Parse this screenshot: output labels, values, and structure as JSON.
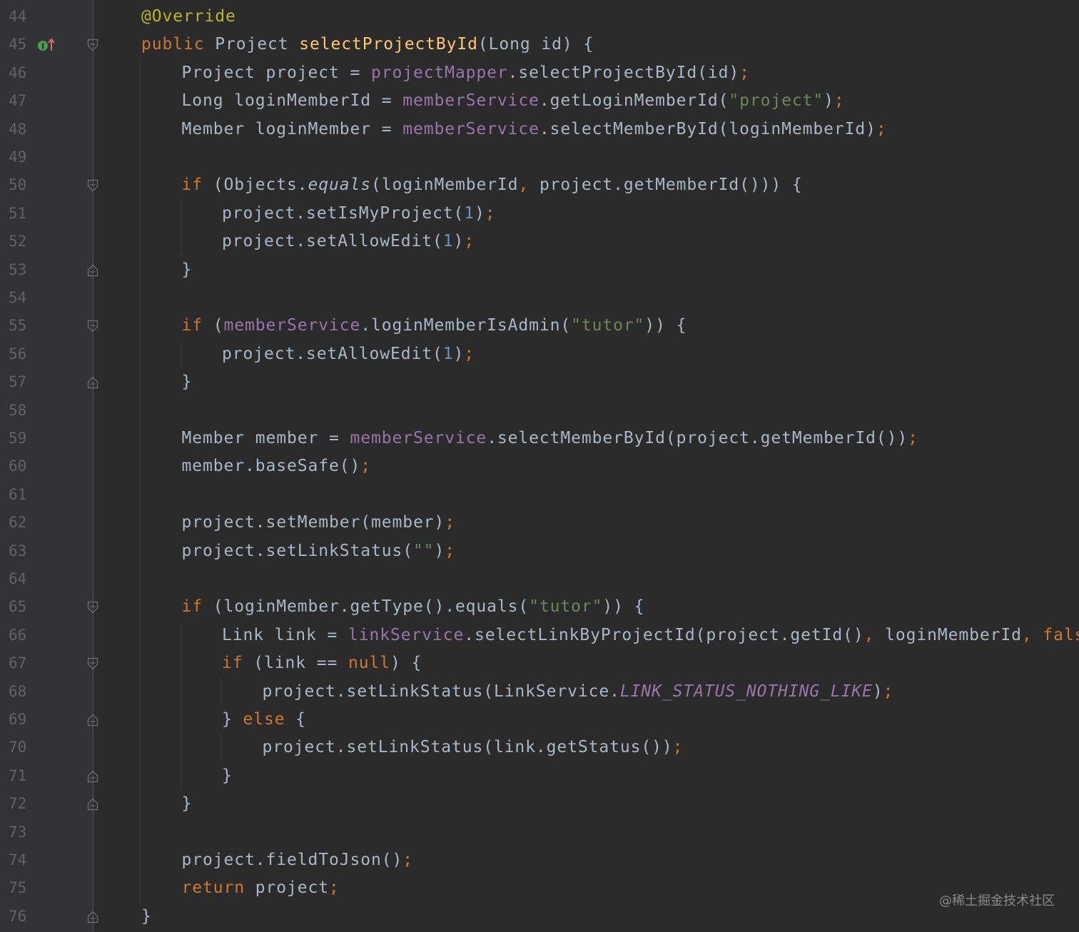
{
  "editor": {
    "lines": [
      {
        "num": "44",
        "indent": 0,
        "fold": "",
        "tokens": [
          [
            "ann",
            "@Override"
          ]
        ]
      },
      {
        "num": "45",
        "indent": 0,
        "fold": "open",
        "tokens": [
          [
            "kw",
            "public "
          ],
          [
            "plain",
            "Project "
          ],
          [
            "fn",
            "selectProjectById"
          ],
          [
            "plain",
            "(Long id) {"
          ]
        ]
      },
      {
        "num": "46",
        "indent": 1,
        "fold": "",
        "tokens": [
          [
            "plain",
            "Project project = "
          ],
          [
            "fld",
            "projectMapper"
          ],
          [
            "plain",
            ".selectProjectById(id)"
          ],
          [
            "semi",
            ";"
          ]
        ]
      },
      {
        "num": "47",
        "indent": 1,
        "fold": "",
        "tokens": [
          [
            "plain",
            "Long loginMemberId = "
          ],
          [
            "fld",
            "memberService"
          ],
          [
            "plain",
            ".getLoginMemberId("
          ],
          [
            "str",
            "\"project\""
          ],
          [
            "plain",
            ")"
          ],
          [
            "semi",
            ";"
          ]
        ]
      },
      {
        "num": "48",
        "indent": 1,
        "fold": "",
        "tokens": [
          [
            "plain",
            "Member loginMember = "
          ],
          [
            "fld",
            "memberService"
          ],
          [
            "plain",
            ".selectMemberById(loginMemberId)"
          ],
          [
            "semi",
            ";"
          ]
        ]
      },
      {
        "num": "49",
        "indent": 0,
        "fold": "",
        "tokens": []
      },
      {
        "num": "50",
        "indent": 1,
        "fold": "open",
        "tokens": [
          [
            "kw",
            "if "
          ],
          [
            "plain",
            "(Objects."
          ],
          [
            "ital",
            "equals"
          ],
          [
            "plain",
            "(loginMemberId"
          ],
          [
            "semi",
            ", "
          ],
          [
            "plain",
            "project.getMemberId())) {"
          ]
        ]
      },
      {
        "num": "51",
        "indent": 2,
        "fold": "",
        "tokens": [
          [
            "plain",
            "project.setIsMyProject("
          ],
          [
            "num",
            "1"
          ],
          [
            "plain",
            ")"
          ],
          [
            "semi",
            ";"
          ]
        ]
      },
      {
        "num": "52",
        "indent": 2,
        "fold": "",
        "tokens": [
          [
            "plain",
            "project.setAllowEdit("
          ],
          [
            "num",
            "1"
          ],
          [
            "plain",
            ")"
          ],
          [
            "semi",
            ";"
          ]
        ]
      },
      {
        "num": "53",
        "indent": 1,
        "fold": "close",
        "tokens": [
          [
            "plain",
            "}"
          ]
        ]
      },
      {
        "num": "54",
        "indent": 0,
        "fold": "",
        "tokens": []
      },
      {
        "num": "55",
        "indent": 1,
        "fold": "open",
        "tokens": [
          [
            "kw",
            "if "
          ],
          [
            "plain",
            "("
          ],
          [
            "fld",
            "memberService"
          ],
          [
            "plain",
            ".loginMemberIsAdmin("
          ],
          [
            "str",
            "\"tutor\""
          ],
          [
            "plain",
            ")) {"
          ]
        ]
      },
      {
        "num": "56",
        "indent": 2,
        "fold": "",
        "tokens": [
          [
            "plain",
            "project.setAllowEdit("
          ],
          [
            "num",
            "1"
          ],
          [
            "plain",
            ")"
          ],
          [
            "semi",
            ";"
          ]
        ]
      },
      {
        "num": "57",
        "indent": 1,
        "fold": "close",
        "tokens": [
          [
            "plain",
            "}"
          ]
        ]
      },
      {
        "num": "58",
        "indent": 0,
        "fold": "",
        "tokens": []
      },
      {
        "num": "59",
        "indent": 1,
        "fold": "",
        "tokens": [
          [
            "plain",
            "Member member = "
          ],
          [
            "fld",
            "memberService"
          ],
          [
            "plain",
            ".selectMemberById(project.getMemberId())"
          ],
          [
            "semi",
            ";"
          ]
        ]
      },
      {
        "num": "60",
        "indent": 1,
        "fold": "",
        "tokens": [
          [
            "plain",
            "member.baseSafe()"
          ],
          [
            "semi",
            ";"
          ]
        ]
      },
      {
        "num": "61",
        "indent": 0,
        "fold": "",
        "tokens": []
      },
      {
        "num": "62",
        "indent": 1,
        "fold": "",
        "tokens": [
          [
            "plain",
            "project.setMember(member)"
          ],
          [
            "semi",
            ";"
          ]
        ]
      },
      {
        "num": "63",
        "indent": 1,
        "fold": "",
        "tokens": [
          [
            "plain",
            "project.setLinkStatus("
          ],
          [
            "str",
            "\"\""
          ],
          [
            "plain",
            ")"
          ],
          [
            "semi",
            ";"
          ]
        ]
      },
      {
        "num": "64",
        "indent": 0,
        "fold": "",
        "tokens": []
      },
      {
        "num": "65",
        "indent": 1,
        "fold": "open",
        "tokens": [
          [
            "kw",
            "if "
          ],
          [
            "plain",
            "(loginMember.getType().equals("
          ],
          [
            "str",
            "\"tutor\""
          ],
          [
            "plain",
            ")) {"
          ]
        ]
      },
      {
        "num": "66",
        "indent": 2,
        "fold": "",
        "tokens": [
          [
            "plain",
            "Link link = "
          ],
          [
            "fld",
            "linkService"
          ],
          [
            "plain",
            ".selectLinkByProjectId(project.getId()"
          ],
          [
            "semi",
            ", "
          ],
          [
            "plain",
            "loginMemberId"
          ],
          [
            "semi",
            ", "
          ],
          [
            "kw",
            "false"
          ],
          [
            "plain",
            ")"
          ],
          [
            "semi",
            ";"
          ]
        ]
      },
      {
        "num": "67",
        "indent": 2,
        "fold": "open",
        "tokens": [
          [
            "kw",
            "if "
          ],
          [
            "plain",
            "(link == "
          ],
          [
            "kw",
            "null"
          ],
          [
            "plain",
            ") {"
          ]
        ]
      },
      {
        "num": "68",
        "indent": 3,
        "fold": "",
        "tokens": [
          [
            "plain",
            "project.setLinkStatus(LinkService."
          ],
          [
            "static",
            "LINK_STATUS_NOTHING_LIKE"
          ],
          [
            "plain",
            ")"
          ],
          [
            "semi",
            ";"
          ]
        ]
      },
      {
        "num": "69",
        "indent": 2,
        "fold": "close",
        "tokens": [
          [
            "plain",
            "} "
          ],
          [
            "kw",
            "else "
          ],
          [
            "plain",
            "{"
          ]
        ]
      },
      {
        "num": "70",
        "indent": 3,
        "fold": "",
        "tokens": [
          [
            "plain",
            "project.setLinkStatus(link.getStatus())"
          ],
          [
            "semi",
            ";"
          ]
        ]
      },
      {
        "num": "71",
        "indent": 2,
        "fold": "close",
        "tokens": [
          [
            "plain",
            "}"
          ]
        ]
      },
      {
        "num": "72",
        "indent": 1,
        "fold": "close",
        "tokens": [
          [
            "plain",
            "}"
          ]
        ]
      },
      {
        "num": "73",
        "indent": 0,
        "fold": "",
        "tokens": []
      },
      {
        "num": "74",
        "indent": 1,
        "fold": "",
        "tokens": [
          [
            "plain",
            "project.fieldToJson()"
          ],
          [
            "semi",
            ";"
          ]
        ]
      },
      {
        "num": "75",
        "indent": 1,
        "fold": "",
        "tokens": [
          [
            "kw",
            "return "
          ],
          [
            "plain",
            "project"
          ],
          [
            "semi",
            ";"
          ]
        ]
      },
      {
        "num": "76",
        "indent": 0,
        "fold": "close",
        "tokens": [
          [
            "plain",
            "}"
          ]
        ]
      }
    ]
  },
  "gutter": {
    "override_icon": "override-method-icon",
    "override_marker_line": "45"
  },
  "watermark": "@稀土掘金技术社区",
  "colors": {
    "background": "#2b2b2b",
    "gutter": "#313335",
    "keyword": "#cc7832",
    "annotation": "#bbb529",
    "method_declaration": "#ffc66d",
    "field": "#9876aa",
    "string": "#6a8759",
    "number": "#6897bb",
    "text": "#a9b7c6",
    "line_number": "#606366"
  }
}
